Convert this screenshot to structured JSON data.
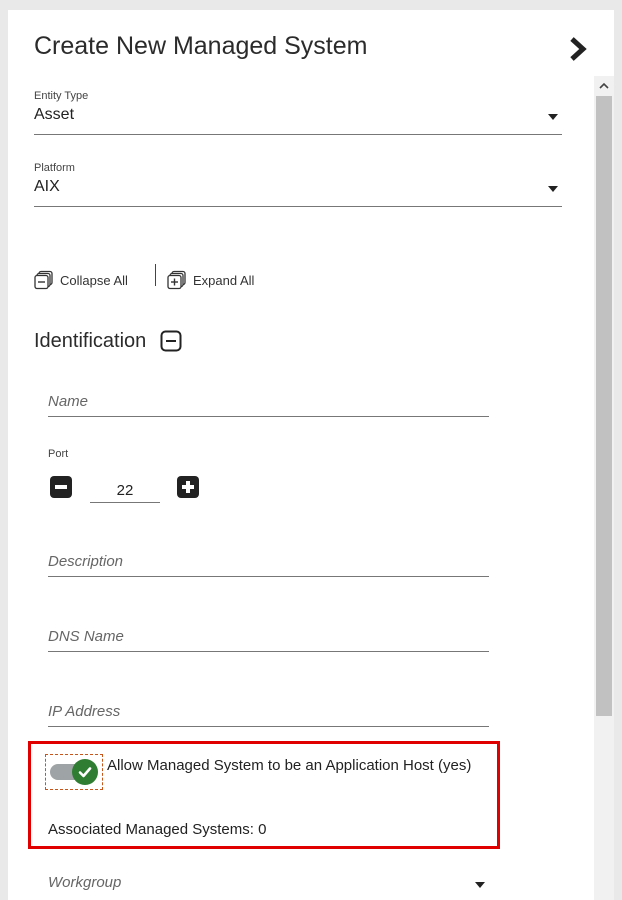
{
  "panel": {
    "title": "Create New Managed System",
    "toggle_icon": "chevron-right-icon"
  },
  "entity_type": {
    "label": "Entity Type",
    "value": "Asset"
  },
  "platform": {
    "label": "Platform",
    "value": "AIX"
  },
  "collapse_all_label": "Collapse All",
  "expand_all_label": "Expand All",
  "identification": {
    "title": "Identification",
    "name_placeholder": "Name",
    "port_label": "Port",
    "port_value": "22",
    "description_placeholder": "Description",
    "dns_placeholder": "DNS Name",
    "ip_placeholder": "IP Address"
  },
  "app_host": {
    "toggle_label": "Allow Managed System to be an Application Host (yes)",
    "toggle_state": "on",
    "associated": "Associated Managed Systems: 0"
  },
  "workgroup": {
    "placeholder": "Workgroup"
  },
  "colors": {
    "toggle_on": "#2e7d32",
    "highlight": "#e00000",
    "focus_outline": "#c8561b"
  }
}
